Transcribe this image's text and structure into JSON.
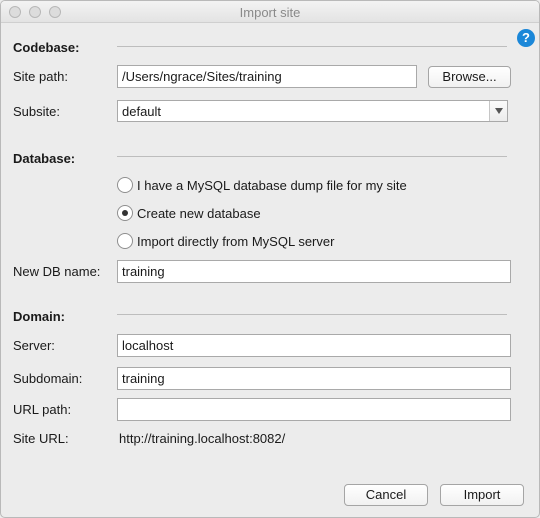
{
  "window": {
    "title": "Import site"
  },
  "help": {
    "glyph": "?"
  },
  "codebase": {
    "heading": "Codebase:",
    "site_path_label": "Site path:",
    "site_path_value": "/Users/ngrace/Sites/training",
    "browse_label": "Browse...",
    "subsite_label": "Subsite:",
    "subsite_value": "default"
  },
  "database": {
    "heading": "Database:",
    "options": [
      {
        "label": "I have a MySQL database dump file for my site",
        "selected": false
      },
      {
        "label": "Create new database",
        "selected": true
      },
      {
        "label": "Import directly from MySQL server",
        "selected": false
      }
    ],
    "new_db_label": "New DB name:",
    "new_db_value": "training"
  },
  "domain": {
    "heading": "Domain:",
    "server_label": "Server:",
    "server_value": "localhost",
    "subdomain_label": "Subdomain:",
    "subdomain_value": "training",
    "urlpath_label": "URL path:",
    "urlpath_value": "",
    "siteurl_label": "Site URL:",
    "siteurl_value": "http://training.localhost:8082/"
  },
  "buttons": {
    "cancel": "Cancel",
    "import": "Import"
  },
  "colors": {
    "help_blue": "#1b87d8",
    "window_bg": "#ececec"
  }
}
